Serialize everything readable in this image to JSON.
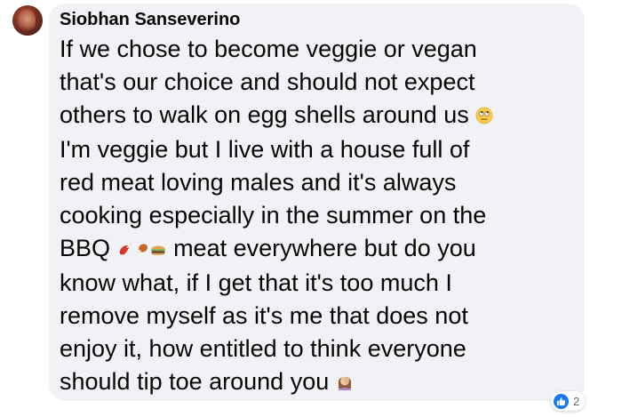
{
  "comment": {
    "author": "Siobhan Sanseverino",
    "lines": {
      "l1": "If we chose to become veggie or vegan",
      "l2": "that's our choice and should not expect",
      "l3": "others to walk on egg shells around us",
      "l4": "I'm veggie but I live with a house full of",
      "l5": "red meat loving males and it's always",
      "l6": "cooking especially in the summer on the",
      "l7a": "BBQ",
      "l7b": "meat everywhere but do you",
      "l8": "know what, if I get that it's too much I",
      "l9": "remove myself as it's me that does not",
      "l10": "enjoy it, how entitled to think everyone",
      "l11": "should tip toe around you"
    },
    "emojis": {
      "after_l3": "face-with-rolling-eyes-icon",
      "bbq": [
        "meat-on-bone-icon",
        "poultry-leg-icon",
        "hamburger-icon"
      ],
      "after_l11": "woman-facepalming-icon"
    },
    "reactions": {
      "icon": "like-icon",
      "count": "2",
      "color": "#1877f2"
    }
  }
}
